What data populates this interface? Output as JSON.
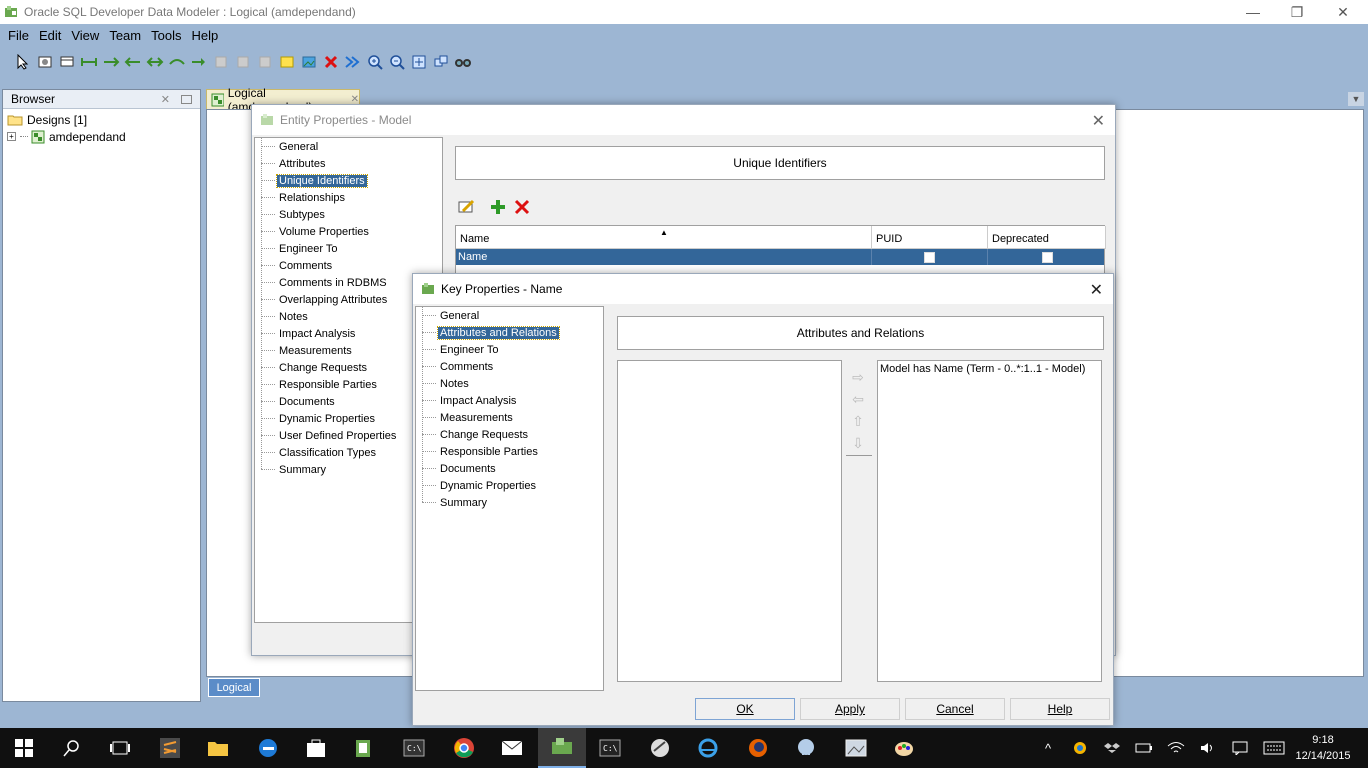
{
  "window": {
    "title": "Oracle SQL Developer Data Modeler : Logical (amdependand)",
    "minimize": "—",
    "restore": "❐",
    "close": "✕"
  },
  "menu": [
    "File",
    "Edit",
    "View",
    "Team",
    "Tools",
    "Help"
  ],
  "toolbar_icons": [
    "pointer-icon",
    "settings-icon",
    "entity-icon",
    "relation-1-1-icon",
    "relation-1-n-icon",
    "relation-n-1-icon",
    "relation-n-n-icon",
    "arc-icon",
    "view-icon",
    "view2-icon",
    "view3-icon",
    "note-icon",
    "picture-icon",
    "delete-icon",
    "engineer-icon",
    "zoom-in-icon",
    "zoom-out-icon",
    "fit-screen-icon",
    "layout-icon",
    "find-icon"
  ],
  "browser": {
    "title": "Browser",
    "tree": [
      {
        "label": "Designs [1]"
      },
      {
        "label": "amdependand"
      }
    ]
  },
  "doc_tab": {
    "label": "Logical (amdependand)"
  },
  "bottom_tab": {
    "label": "Logical"
  },
  "entity_dialog": {
    "title": "Entity Properties - Model",
    "nav": [
      "General",
      "Attributes",
      "Unique Identifiers",
      "Relationships",
      "Subtypes",
      "Volume Properties",
      "Engineer To",
      "Comments",
      "Comments in RDBMS",
      "Overlapping Attributes",
      "Notes",
      "Impact Analysis",
      "Measurements",
      "Change Requests",
      "Responsible Parties",
      "Documents",
      "Dynamic Properties",
      "User Defined Properties",
      "Classification Types",
      "Summary"
    ],
    "selected_index": 2,
    "section_title": "Unique Identifiers",
    "grid": {
      "columns": [
        "Name",
        "PUID",
        "Deprecated"
      ],
      "rows": [
        {
          "name": "Name",
          "puid": false,
          "deprecated": false
        }
      ]
    }
  },
  "key_dialog": {
    "title": "Key Properties - Name",
    "nav": [
      "General",
      "Attributes and Relations",
      "Engineer To",
      "Comments",
      "Notes",
      "Impact Analysis",
      "Measurements",
      "Change Requests",
      "Responsible Parties",
      "Documents",
      "Dynamic Properties",
      "Summary"
    ],
    "selected_index": 1,
    "section_title": "Attributes and Relations",
    "available": [],
    "selected_items": [
      "Model has Name (Term - 0..*:1..1 - Model)"
    ],
    "buttons": {
      "ok": "OK",
      "apply": "Apply",
      "cancel": "Cancel",
      "help": "Help"
    }
  },
  "taskbar": {
    "clock_time": "9:18",
    "clock_date": "12/14/2015"
  }
}
